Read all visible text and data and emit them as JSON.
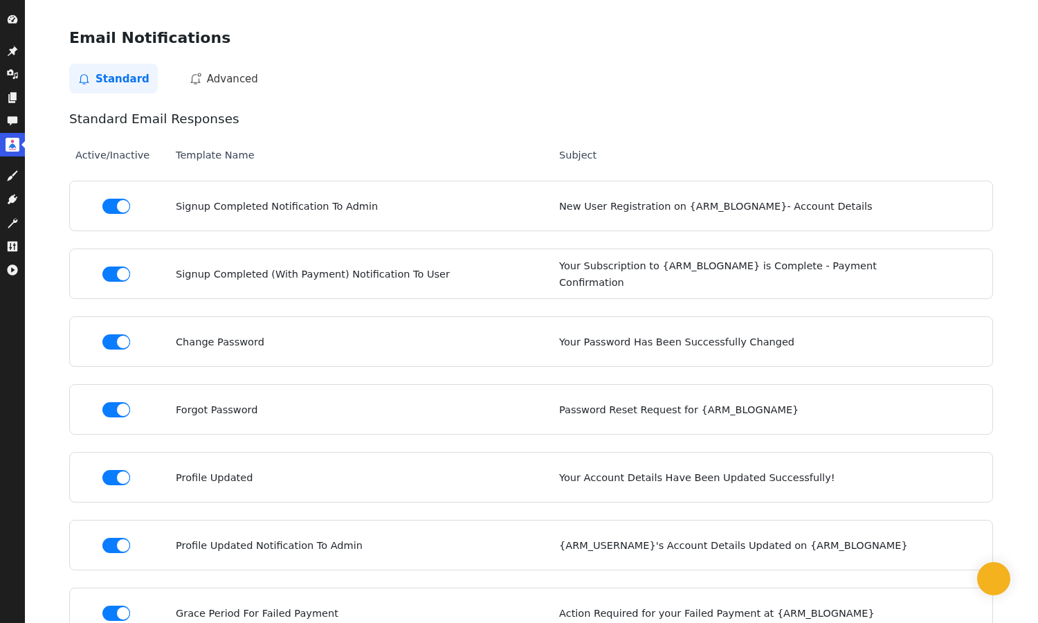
{
  "sidebar": {
    "groups": [
      {
        "items": [
          {
            "kind": "dashboard",
            "selected": false
          }
        ]
      },
      {
        "items": [
          {
            "kind": "pin",
            "selected": false
          },
          {
            "kind": "media",
            "selected": false
          },
          {
            "kind": "pages",
            "selected": false
          },
          {
            "kind": "comments",
            "selected": false
          },
          {
            "kind": "plugin",
            "selected": true
          }
        ]
      },
      {
        "items": [
          {
            "kind": "brush",
            "selected": false
          },
          {
            "kind": "plug",
            "selected": false
          },
          {
            "kind": "wrench",
            "selected": false
          },
          {
            "kind": "sliders",
            "selected": false
          },
          {
            "kind": "play",
            "selected": false
          }
        ]
      }
    ]
  },
  "page": {
    "title": "Email Notifications",
    "tabs": [
      {
        "kind": "plain",
        "label": "Standard",
        "selected": true
      },
      {
        "kind": "dotted",
        "label": "Advanced",
        "selected": false
      }
    ],
    "section_title": "Standard Email Responses",
    "table": {
      "columns": [
        "Active/Inactive",
        "Template Name",
        "Subject"
      ],
      "rows": [
        {
          "on": true,
          "name": "Signup Completed Notification To Admin",
          "subject": "New User Registration on {ARM_BLOGNAME}- Account Details"
        },
        {
          "on": true,
          "name": "Signup Completed (With Payment) Notification To User",
          "subject": "Your Subscription to {ARM_BLOGNAME} is Complete - Payment Confirmation"
        },
        {
          "on": true,
          "name": "Change Password",
          "subject": "Your Password Has Been Successfully Changed"
        },
        {
          "on": true,
          "name": "Forgot Password",
          "subject": "Password Reset Request for {ARM_BLOGNAME}"
        },
        {
          "on": true,
          "name": "Profile Updated",
          "subject": "Your Account Details Have Been Updated Successfully!"
        },
        {
          "on": true,
          "name": "Profile Updated Notification To Admin",
          "subject": "{ARM_USERNAME}'s Account Details Updated on {ARM_BLOGNAME}"
        },
        {
          "on": true,
          "name": "Grace Period For Failed Payment",
          "subject": "Action Required for your Failed Payment at {ARM_BLOGNAME}"
        }
      ]
    }
  }
}
